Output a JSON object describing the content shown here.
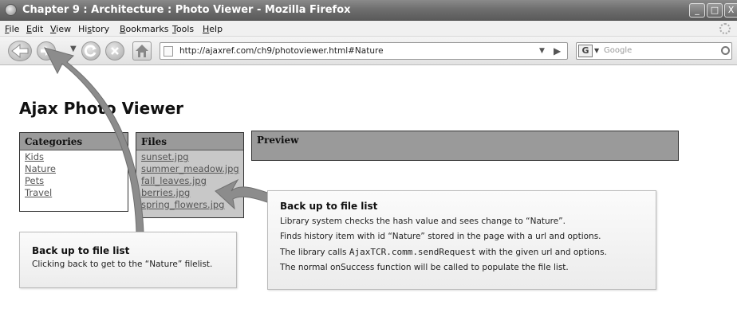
{
  "window": {
    "title": "Chapter 9 : Architecture : Photo Viewer - Mozilla Firefox",
    "minimize": "_",
    "maximize": "□",
    "close": "X"
  },
  "menu": {
    "items": [
      {
        "key": "F",
        "rest": "ile"
      },
      {
        "key": "E",
        "rest": "dit"
      },
      {
        "key": "V",
        "rest": "iew"
      },
      {
        "pre": "Hi",
        "key": "s",
        "rest": "tory"
      },
      {
        "key": "B",
        "rest": "ookmarks"
      },
      {
        "key": "T",
        "rest": "ools"
      },
      {
        "key": "H",
        "rest": "elp"
      }
    ]
  },
  "toolbar": {
    "url": "http://ajaxref.com/ch9/photoviewer.html#Nature",
    "search_engine": "G",
    "search_placeholder": "Google"
  },
  "page": {
    "title": "Ajax Photo Viewer",
    "categories": {
      "heading": "Categories",
      "items": [
        "Kids",
        "Nature",
        "Pets",
        "Travel"
      ]
    },
    "files": {
      "heading": "Files",
      "items": [
        "sunset.jpg",
        "summer_meadow.jpg",
        "fall_leaves.jpg",
        "berries.jpg",
        "spring_flowers.jpg"
      ]
    },
    "preview": {
      "heading": "Preview"
    }
  },
  "callouts": {
    "left": {
      "title": "Back up to file list",
      "line1": "Clicking back to get to the “Nature” filelist."
    },
    "right": {
      "title": "Back up to file list",
      "line1": "Library system checks the hash value and sees change to  “Nature”.",
      "line2": "Finds history item with id “Nature” stored in the page with a url and options.",
      "line3_pre": "The library calls ",
      "line3_code": "AjaxTCR.comm.sendRequest",
      "line3_post": " with the given url and options.",
      "line4": "The normal onSuccess function will be called to populate the file list."
    }
  },
  "colors": {
    "panel_header": "#9a9a9a",
    "arrow": "#8c8c8c",
    "titlebar": "#6f6f6f"
  }
}
